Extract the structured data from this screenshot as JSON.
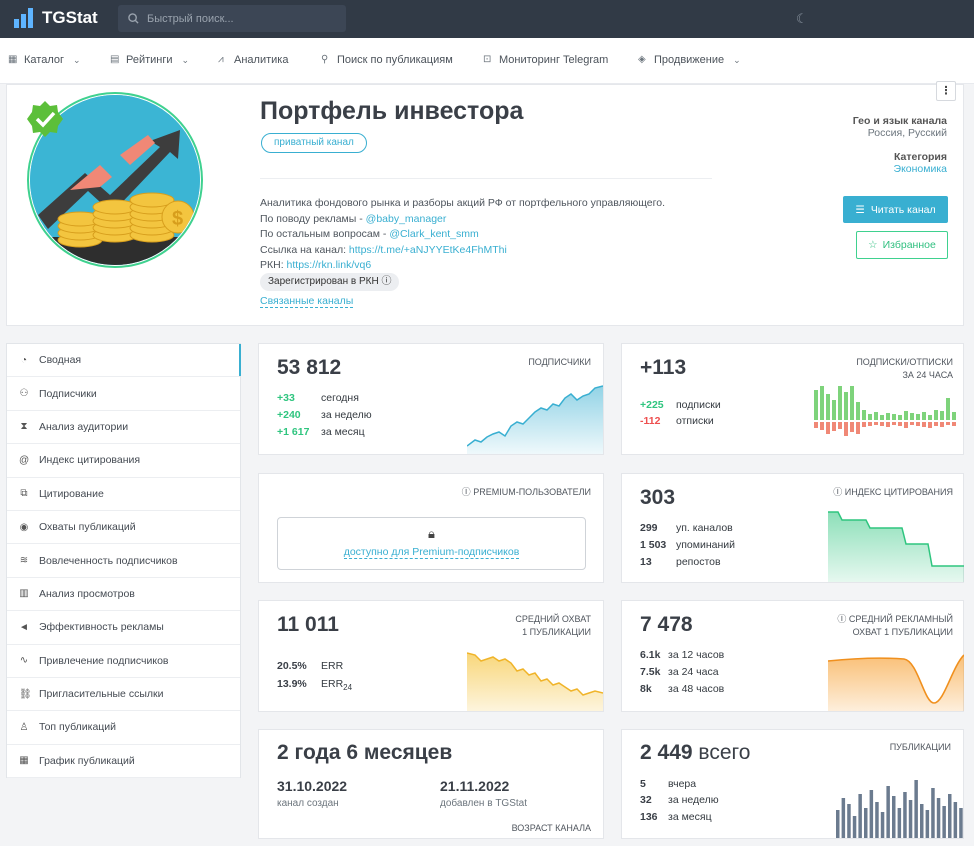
{
  "app": {
    "logo_text": "TGStat",
    "search_placeholder": "Быстрый поиск..."
  },
  "nav": [
    {
      "label": "Каталог",
      "icon": "grid-icon",
      "dropdown": true
    },
    {
      "label": "Рейтинги",
      "icon": "ratings-icon",
      "dropdown": true
    },
    {
      "label": "Аналитика",
      "icon": "analytics-icon",
      "dropdown": false
    },
    {
      "label": "Поиск по публикациям",
      "icon": "search-icon",
      "dropdown": false
    },
    {
      "label": "Мониторинг Telegram",
      "icon": "monitor-icon",
      "dropdown": false
    },
    {
      "label": "Продвижение",
      "icon": "promo-icon",
      "dropdown": true
    }
  ],
  "channel": {
    "title": "Портфель инвестора",
    "type_badge": "приватный канал",
    "desc_line1": "Аналитика фондового рынка и разборы акций РФ от портфельного управляющего.",
    "desc_ads_prefix": "По поводу рекламы - ",
    "desc_ads_link": "@baby_manager",
    "desc_other_prefix": "По остальным вопросам - ",
    "desc_other_link": "@Clark_kent_smm",
    "desc_link_prefix": "Ссылка на канал: ",
    "desc_link": "https://t.me/+aNJYYEtKe4FhMThi",
    "desc_rkn_prefix": "РКН: ",
    "desc_rkn_link": "https://rkn.link/vq6",
    "rkn_badge": "Зарегистрирован в РКН",
    "linked_label": "Связанные каналы",
    "geo_label": "Гео и язык канала",
    "geo_value": "Россия, Русский",
    "category_label": "Категория",
    "category_value": "Экономика",
    "read_button": "Читать канал",
    "fav_button": "Избранное"
  },
  "sidebar": [
    "Сводная",
    "Подписчики",
    "Анализ аудитории",
    "Индекс цитирования",
    "Цитирование",
    "Охваты публикаций",
    "Вовлеченность подписчиков",
    "Анализ просмотров",
    "Эффективность рекламы",
    "Привлечение подписчиков",
    "Пригласительные ссылки",
    "Топ публикаций",
    "График публикаций"
  ],
  "sidebar_icons": [
    "gauge-icon",
    "users-icon",
    "audience-icon",
    "at-icon",
    "quote-icon",
    "eye-icon",
    "engagement-icon",
    "bars-icon",
    "megaphone-icon",
    "trend-icon",
    "link-icon",
    "thumb-up-icon",
    "calendar-icon"
  ],
  "cards": {
    "subscribers": {
      "value": "53 812",
      "label": "подписчики",
      "rows": [
        {
          "v": "+33",
          "t": "сегодня"
        },
        {
          "v": "+240",
          "t": "за неделю"
        },
        {
          "v": "+1 617",
          "t": "за месяц"
        }
      ]
    },
    "subs_24h": {
      "value": "+113",
      "label1": "подписки/отписки",
      "label2": "за 24 часа",
      "rows": [
        {
          "v": "+225",
          "t": "подписки"
        },
        {
          "v": "-112",
          "t": "отписки"
        }
      ]
    },
    "premium": {
      "label": "premium-пользователи",
      "link": "доступно для Premium-подписчиков"
    },
    "citation": {
      "value": "303",
      "label": "индекс цитирования",
      "rows": [
        {
          "v": "299",
          "t": "уп. каналов"
        },
        {
          "v": "1 503",
          "t": "упоминаний"
        },
        {
          "v": "13",
          "t": "репостов"
        }
      ]
    },
    "reach": {
      "value": "11 011",
      "label1": "средний охват",
      "label2": "1 публикации",
      "rows": [
        {
          "v": "20.5%",
          "t": "ERR"
        },
        {
          "v": "13.9%",
          "t": "ERR",
          "sub": "24"
        }
      ]
    },
    "ad_reach": {
      "value": "7 478",
      "label1": "средний рекламный",
      "label2": "охват 1 публикации",
      "rows": [
        {
          "v": "6.1k",
          "t": "за 12 часов"
        },
        {
          "v": "7.5k",
          "t": "за 24 часа"
        },
        {
          "v": "8k",
          "t": "за 48 часов"
        }
      ]
    },
    "age": {
      "value": "2 года 6 месяцев",
      "created_date": "31.10.2022",
      "created_label": "канал создан",
      "added_date": "21.11.2022",
      "added_label": "добавлен в TGStat",
      "label": "возраст канала"
    },
    "posts": {
      "value": "2 449",
      "value_suffix": "всего",
      "label": "публикации",
      "rows": [
        {
          "v": "5",
          "t": "вчера"
        },
        {
          "v": "32",
          "t": "за неделю"
        },
        {
          "v": "136",
          "t": "за месяц"
        }
      ]
    }
  },
  "colors": {
    "accent": "#39afd1",
    "green": "#2fc57f",
    "red": "#ee4f4f",
    "orange": "#f7a43b",
    "yellow": "#f5c542",
    "topbar": "#313a46"
  }
}
